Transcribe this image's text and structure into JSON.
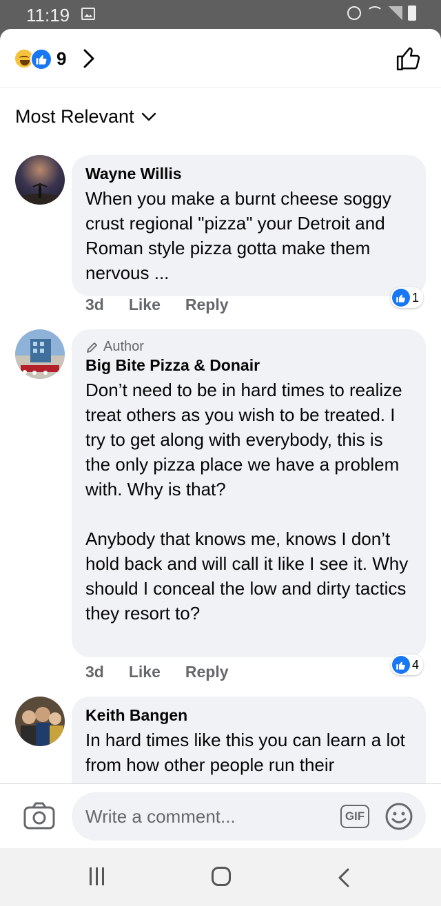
{
  "status_bar": {
    "time": "11:19"
  },
  "reactions": {
    "count": "9"
  },
  "sort": {
    "label": "Most Relevant"
  },
  "comments": [
    {
      "author": "Wayne Willis",
      "text": "When you make a burnt cheese soggy crust regional \"pizza\" your Detroit and Roman  style pizza gotta make them nervous ...",
      "time": "3d",
      "like_label": "Like",
      "reply_label": "Reply",
      "like_count": "1"
    },
    {
      "author_tag": "Author",
      "author": "Big Bite Pizza & Donair",
      "text": "Don’t need to be in hard times to realize treat others as you wish to be treated.  I try to get along with everybody, this is the only pizza place we have a problem with. Why is that?\n\nAnybody that knows me, knows I don’t hold back and will call it like I see it. Why should I conceal the low and dirty tactics they resort to?",
      "time": "3d",
      "like_label": "Like",
      "reply_label": "Reply",
      "like_count": "4"
    },
    {
      "author": "Keith Bangen",
      "text": "In hard times like this you can learn a lot from how other people run their"
    }
  ],
  "composer": {
    "placeholder": "Write a comment...",
    "gif_label": "GIF"
  },
  "colors": {
    "accent": "#1877f2",
    "bubble": "#f0f2f5",
    "muted": "#65676b"
  }
}
